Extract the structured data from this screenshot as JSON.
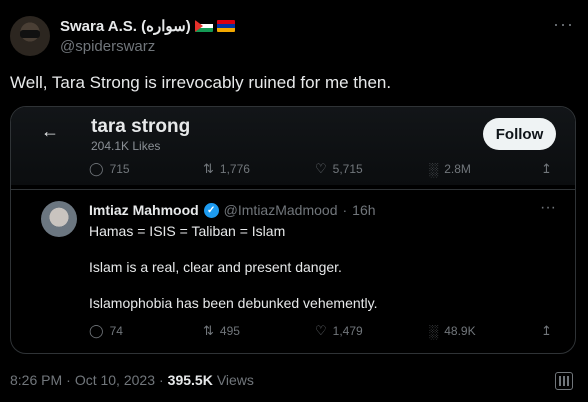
{
  "author": {
    "display_name": "Swara A.S. (سواره)",
    "handle": "@spiderswarz"
  },
  "tweet": {
    "text": "Well, Tara Strong is irrevocably ruined for me then."
  },
  "embedded": {
    "back_glyph": "←",
    "profile_name": "tara strong",
    "profile_likes": "204.1K Likes",
    "follow_label": "Follow",
    "top_actions": {
      "replies": "715",
      "retweets": "1,776",
      "likes": "5,715",
      "views": "2.8M"
    },
    "reply": {
      "name": "Imtiaz Mahmood",
      "handle": "@ImtiazMadmood",
      "time": "16h",
      "line1": "Hamas = ISIS = Taliban = Islam",
      "line2": "Islam is a real, clear and present danger.",
      "line3": "Islamophobia has been debunked vehemently.",
      "actions": {
        "replies": "74",
        "retweets": "495",
        "likes": "1,479",
        "views": "48.9K"
      }
    }
  },
  "meta": {
    "time": "8:26 PM",
    "date": "Oct 10, 2023",
    "views": "395.5K",
    "views_label": "Views"
  },
  "colors": {
    "background": "#000000",
    "text": "#e7e9ea",
    "muted": "#71767b",
    "verified": "#1d9bf0"
  }
}
